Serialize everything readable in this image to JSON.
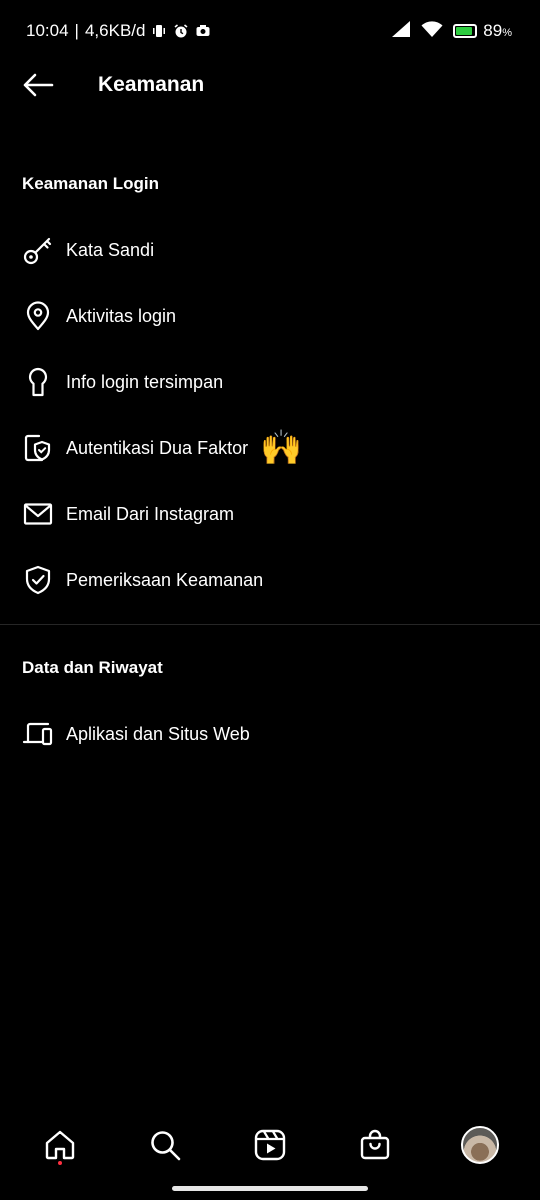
{
  "status_bar": {
    "time": "10:04",
    "network_speed": "4,6KB/d",
    "battery_percent": "89",
    "battery_unit": "%",
    "battery_level": 0.89,
    "battery_color": "#2ecc40"
  },
  "header": {
    "title": "Keamanan",
    "back_icon": "arrow-left-icon"
  },
  "sections": {
    "login": {
      "title": "Keamanan Login",
      "items": [
        {
          "label": "Kata Sandi",
          "icon": "key-icon"
        },
        {
          "label": "Aktivitas login",
          "icon": "location-pin-icon"
        },
        {
          "label": "Info login tersimpan",
          "icon": "keyhole-icon"
        },
        {
          "label": "Autentikasi Dua Faktor",
          "icon": "shield-phone-icon",
          "emoji": "🙌"
        },
        {
          "label": "Email Dari Instagram",
          "icon": "mail-icon"
        },
        {
          "label": "Pemeriksaan Keamanan",
          "icon": "shield-check-icon"
        }
      ]
    },
    "data": {
      "title": "Data dan Riwayat",
      "items": [
        {
          "label": "Aplikasi dan Situs Web",
          "icon": "devices-icon"
        }
      ]
    }
  },
  "bottom_nav": {
    "items": [
      "home-icon",
      "search-icon",
      "reels-icon",
      "shop-icon",
      "profile-avatar"
    ],
    "notification_dot_color": "#ff3040"
  }
}
